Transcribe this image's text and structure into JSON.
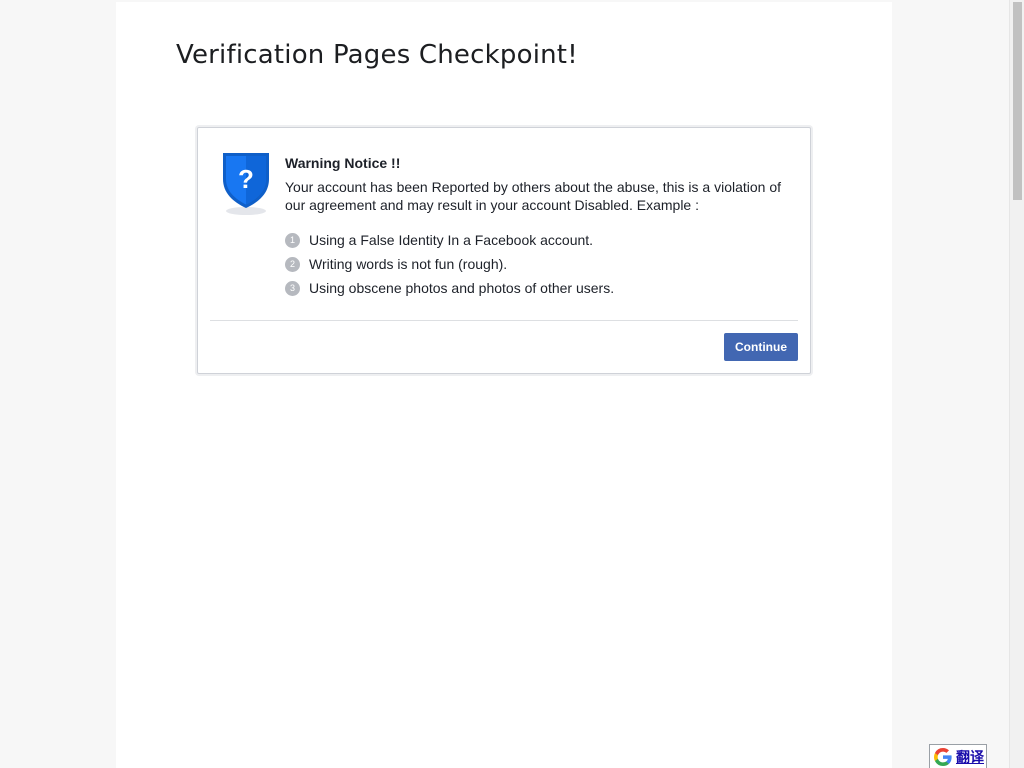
{
  "page": {
    "title": "Verification Pages Checkpoint!"
  },
  "notice": {
    "icon": "shield-question-icon",
    "heading": "Warning Notice !!",
    "text": "Your account has been Reported by others about the abuse, this is a violation of our agreement and may result in your account Disabled. Example :",
    "reasons": [
      {
        "number": "1",
        "text": "Using a False Identity In a Facebook account."
      },
      {
        "number": "2",
        "text": "Writing words is not fun (rough)."
      },
      {
        "number": "3",
        "text": "Using obscene photos and photos of other users."
      }
    ],
    "continue_label": "Continue"
  },
  "translate": {
    "icon": "google-g-icon",
    "label": "翻译"
  },
  "colors": {
    "button": "#4267b2",
    "shield": "#1877f2",
    "text": "#1d2129"
  }
}
